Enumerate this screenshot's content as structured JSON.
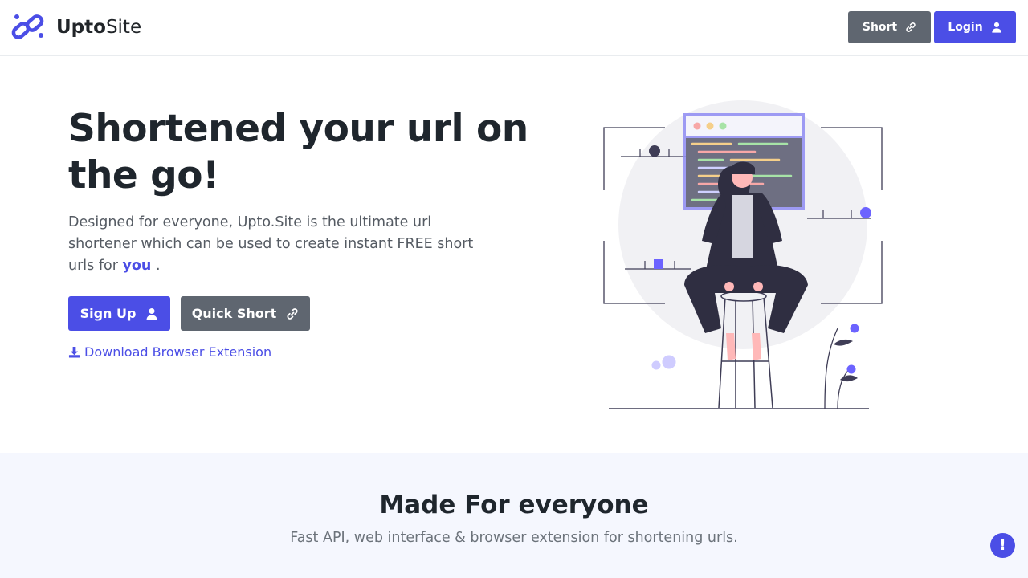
{
  "nav": {
    "brand_bold": "Upto",
    "brand_regular": "Site",
    "short_label": "Short",
    "login_label": "Login"
  },
  "hero": {
    "title": "Shortened your url on the go!",
    "description_pre": "Designed for everyone, Upto.Site is the ultimate url shortener which can be used to create instant FREE short urls for",
    "description_highlight": "you",
    "description_post": " .",
    "signup_label": "Sign Up",
    "quick_short_label": "Quick Short",
    "download_label": "Download Browser Extension"
  },
  "features": {
    "title": "Made For everyone",
    "sub_pre": "Fast API, ",
    "sub_link": "web interface & browser extension",
    "sub_post": " for shortening urls."
  },
  "help": {
    "label": "!"
  },
  "colors": {
    "primary": "#4b4ee6",
    "secondary": "#5f6670",
    "heading": "#1f262d",
    "section_bg": "#f5f7fe"
  },
  "icons": [
    "brand-link-icon",
    "link-icon",
    "user-icon",
    "download-icon",
    "exclamation-icon"
  ]
}
